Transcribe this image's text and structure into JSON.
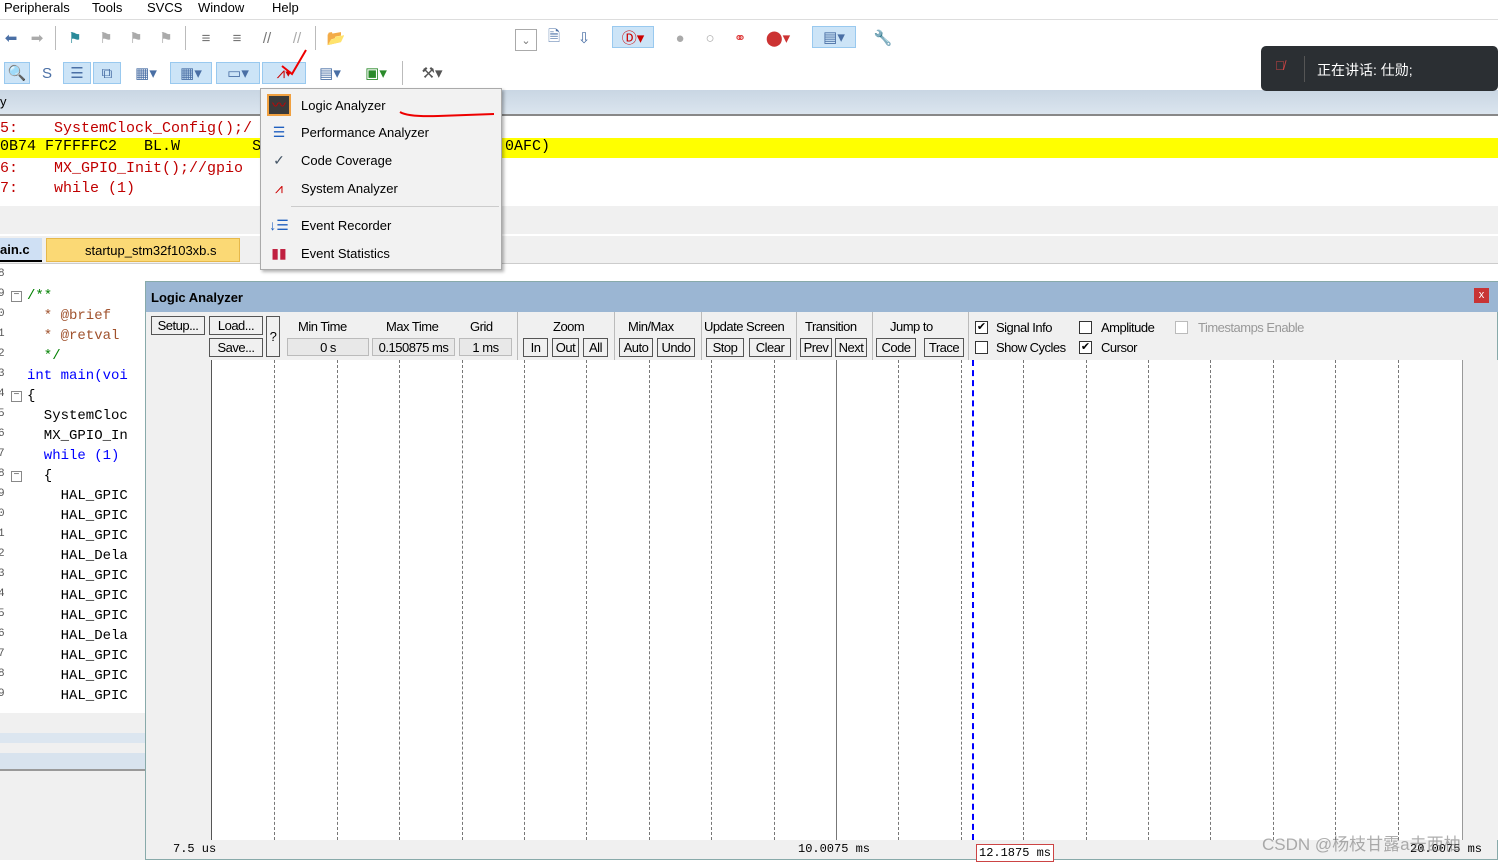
{
  "menu": [
    "Peripherals",
    "Tools",
    "SVCS",
    "Window",
    "Help"
  ],
  "code_top": {
    "pane_label": "y",
    "lines": [
      {
        "num": "5:",
        "text": "SystemClock_Config();/",
        "color": "#c00000"
      },
      {
        "num": "0B74",
        "text": "F7FFFFC2   BL.W        Sy",
        "highlight": true,
        "tail": "0AFC)"
      },
      {
        "num": "6:",
        "text": "MX_GPIO_Init();//gpio",
        "color": "#c00000"
      },
      {
        "num": "7:",
        "text": "while (1)",
        "color": "#c00000"
      }
    ]
  },
  "tabs": [
    {
      "label": "ain.c",
      "active": true
    },
    {
      "label": "startup_stm32f103xb.s",
      "active": false
    }
  ],
  "dropdown": {
    "items": [
      {
        "label": "Logic Analyzer",
        "icon": "logic-analyzer-icon",
        "selected": true
      },
      {
        "label": "Performance Analyzer",
        "icon": "performance-analyzer-icon"
      },
      {
        "label": "Code Coverage",
        "icon": "code-coverage-icon",
        "icon_text": "CODE"
      },
      {
        "label": "System Analyzer",
        "icon": "system-analyzer-icon"
      },
      {
        "label": "Event Recorder",
        "icon": "event-recorder-icon"
      },
      {
        "label": "Event Statistics",
        "icon": "event-statistics-icon"
      }
    ]
  },
  "notification": {
    "text": "正在讲话: 仕勋;"
  },
  "editor": {
    "lines": [
      {
        "n": "8",
        "t": "",
        "c": "#000"
      },
      {
        "n": "9",
        "t": "/**",
        "c": "#008000",
        "fold": true
      },
      {
        "n": "0",
        "t": "  * @brief",
        "c": "#a0522d"
      },
      {
        "n": "1",
        "t": "  * @retval",
        "c": "#a0522d"
      },
      {
        "n": "2",
        "t": "  */",
        "c": "#008000"
      },
      {
        "n": "3",
        "t": "int main(voi",
        "c": "#0000ff"
      },
      {
        "n": "4",
        "t": "{",
        "c": "#000",
        "fold": true
      },
      {
        "n": "5",
        "t": "  SystemCloc",
        "c": "#000"
      },
      {
        "n": "6",
        "t": "  MX_GPIO_In",
        "c": "#000"
      },
      {
        "n": "7",
        "t": "  while (1)",
        "c": "#0000ff"
      },
      {
        "n": "8",
        "t": "  {",
        "c": "#000",
        "fold": true
      },
      {
        "n": "9",
        "t": "    HAL_GPIC",
        "c": "#000"
      },
      {
        "n": "0",
        "t": "    HAL_GPIC",
        "c": "#000"
      },
      {
        "n": "1",
        "t": "    HAL_GPIC",
        "c": "#000"
      },
      {
        "n": "2",
        "t": "    HAL_Dela",
        "c": "#000"
      },
      {
        "n": "3",
        "t": "    HAL_GPIC",
        "c": "#000"
      },
      {
        "n": "4",
        "t": "    HAL_GPIC",
        "c": "#000"
      },
      {
        "n": "5",
        "t": "    HAL_GPIC",
        "c": "#000"
      },
      {
        "n": "6",
        "t": "    HAL_Dela",
        "c": "#000"
      },
      {
        "n": "7",
        "t": "    HAL_GPIC",
        "c": "#000"
      },
      {
        "n": "8",
        "t": "    HAL_GPIC",
        "c": "#000"
      },
      {
        "n": "9",
        "t": "    HAL_GPIC",
        "c": "#000"
      }
    ]
  },
  "logic_analyzer": {
    "title": "Logic Analyzer",
    "close": "x",
    "setup": "Setup...",
    "load": "Load...",
    "save": "Save...",
    "help": "?",
    "min_time_label": "Min Time",
    "min_time": "0 s",
    "max_time_label": "Max Time",
    "max_time": "0.150875 ms",
    "grid_label": "Grid",
    "grid": "1 ms",
    "zoom_label": "Zoom",
    "zoom_in": "In",
    "zoom_out": "Out",
    "zoom_all": "All",
    "minmax_label": "Min/Max",
    "auto": "Auto",
    "undo": "Undo",
    "update_label": "Update Screen",
    "stop": "Stop",
    "clear": "Clear",
    "transition_label": "Transition",
    "prev": "Prev",
    "next": "Next",
    "jump_label": "Jump to",
    "code": "Code",
    "trace": "Trace",
    "signal_info": {
      "label": "Signal Info",
      "checked": true
    },
    "amplitude": {
      "label": "Amplitude",
      "checked": false
    },
    "timestamps": {
      "label": "Timestamps Enable",
      "checked": false,
      "disabled": true
    },
    "show_cycles": {
      "label": "Show Cycles",
      "checked": false
    },
    "cursor": {
      "label": "Cursor",
      "checked": true
    },
    "axis": {
      "left": "7.5 us",
      "mid": "10.0075 ms",
      "cursor": "12.1875 ms",
      "right": "20.0075 ms"
    },
    "cursor_color": "#0000ff"
  },
  "watermark": "CSDN @杨枝甘露a去西柚"
}
